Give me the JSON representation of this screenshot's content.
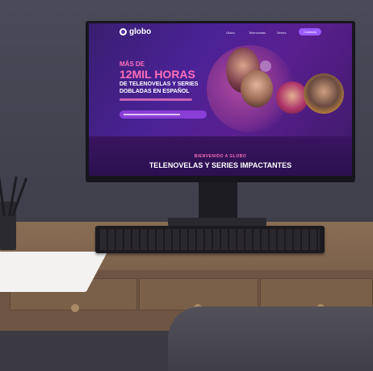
{
  "screen": {
    "logo_text": "globo",
    "nav": [
      "Globo",
      "Telenovelas",
      "Series"
    ],
    "nav_cta": "Contacto",
    "hero": {
      "line1": "MÁS DE",
      "line2": "12MIL HORAS",
      "line3": "DE TELENOVELAS Y SERIES",
      "line4": "DOBLADAS EN ESPAÑOL"
    },
    "welcome": "BIENVENIDO A GLOBO",
    "headline": "TELENOVELAS Y SERIES IMPACTANTES"
  },
  "colors": {
    "screen_purple": "#4a2296",
    "accent_pink": "#ff6fb8",
    "cta_purple": "#9b59ff",
    "desk_wood": "#7c624c"
  }
}
